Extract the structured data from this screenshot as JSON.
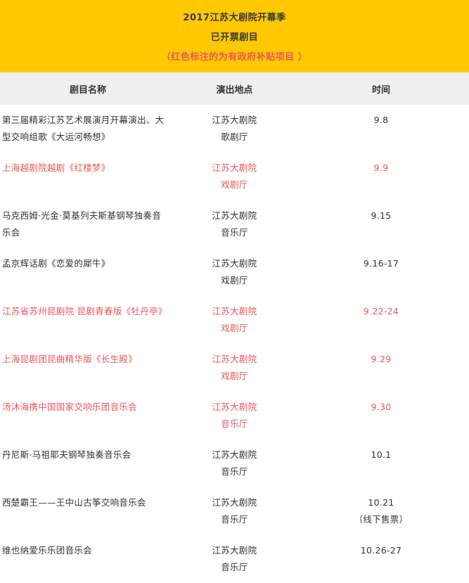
{
  "header": {
    "line1": "2017江苏大剧院开幕季",
    "line2": "已开票剧目",
    "line3": "（红色标注的为有政府补贴项目 ）",
    "highlight_color": "#e8585a",
    "banner_color": "#ffc800"
  },
  "columns": [
    "剧目名称",
    "演出地点",
    "时间"
  ],
  "rows": [
    {
      "title": "第三届精彩江苏艺术展演月开幕演出、大型交响组歌《大运河畅想》",
      "venue": "江苏大剧院",
      "hall": "歌剧厅",
      "date": "9.8",
      "note": "",
      "subsidized": false
    },
    {
      "title": "上海越剧院越剧《红楼梦》",
      "venue": "江苏大剧院",
      "hall": "戏剧厅",
      "date": "9.9",
      "note": "",
      "subsidized": true
    },
    {
      "title": "马克西姆·光金·莫基列夫斯基钢琴独奏音乐会",
      "venue": "江苏大剧院",
      "hall": "音乐厅",
      "date": "9.15",
      "note": "",
      "subsidized": false
    },
    {
      "title": "孟京辉话剧《恋爱的犀牛》",
      "venue": "江苏大剧院",
      "hall": "戏剧厅",
      "date": "9.16-17",
      "note": "",
      "subsidized": false
    },
    {
      "title": "江苏省苏州昆剧院 昆剧青春版《牡丹亭》",
      "venue": "江苏大剧院",
      "hall": "戏剧厅",
      "date": "9.22-24",
      "note": "",
      "subsidized": true
    },
    {
      "title": "上海昆剧团昆曲精华版《长生殿》",
      "venue": "江苏大剧院",
      "hall": "戏剧厅",
      "date": "9.29",
      "note": "",
      "subsidized": true
    },
    {
      "title": "汤沐海携中国国家交响乐团音乐会",
      "venue": "江苏大剧院",
      "hall": "音乐厅",
      "date": "9.30",
      "note": "",
      "subsidized": true
    },
    {
      "title": "丹尼斯·马祖耶夫钢琴独奏音乐会",
      "venue": "江苏大剧院",
      "hall": "音乐厅",
      "date": "10.1",
      "note": "",
      "subsidized": false
    },
    {
      "title": "西楚霸王——王中山古筝交响音乐会",
      "venue": "江苏大剧院",
      "hall": "音乐厅",
      "date": "10.21",
      "note": "（线下售票）",
      "subsidized": false
    },
    {
      "title": "维也纳爱乐乐团音乐会",
      "venue": "江苏大剧院",
      "hall": "音乐厅",
      "date": "10.26-27",
      "note": "",
      "subsidized": false
    }
  ]
}
